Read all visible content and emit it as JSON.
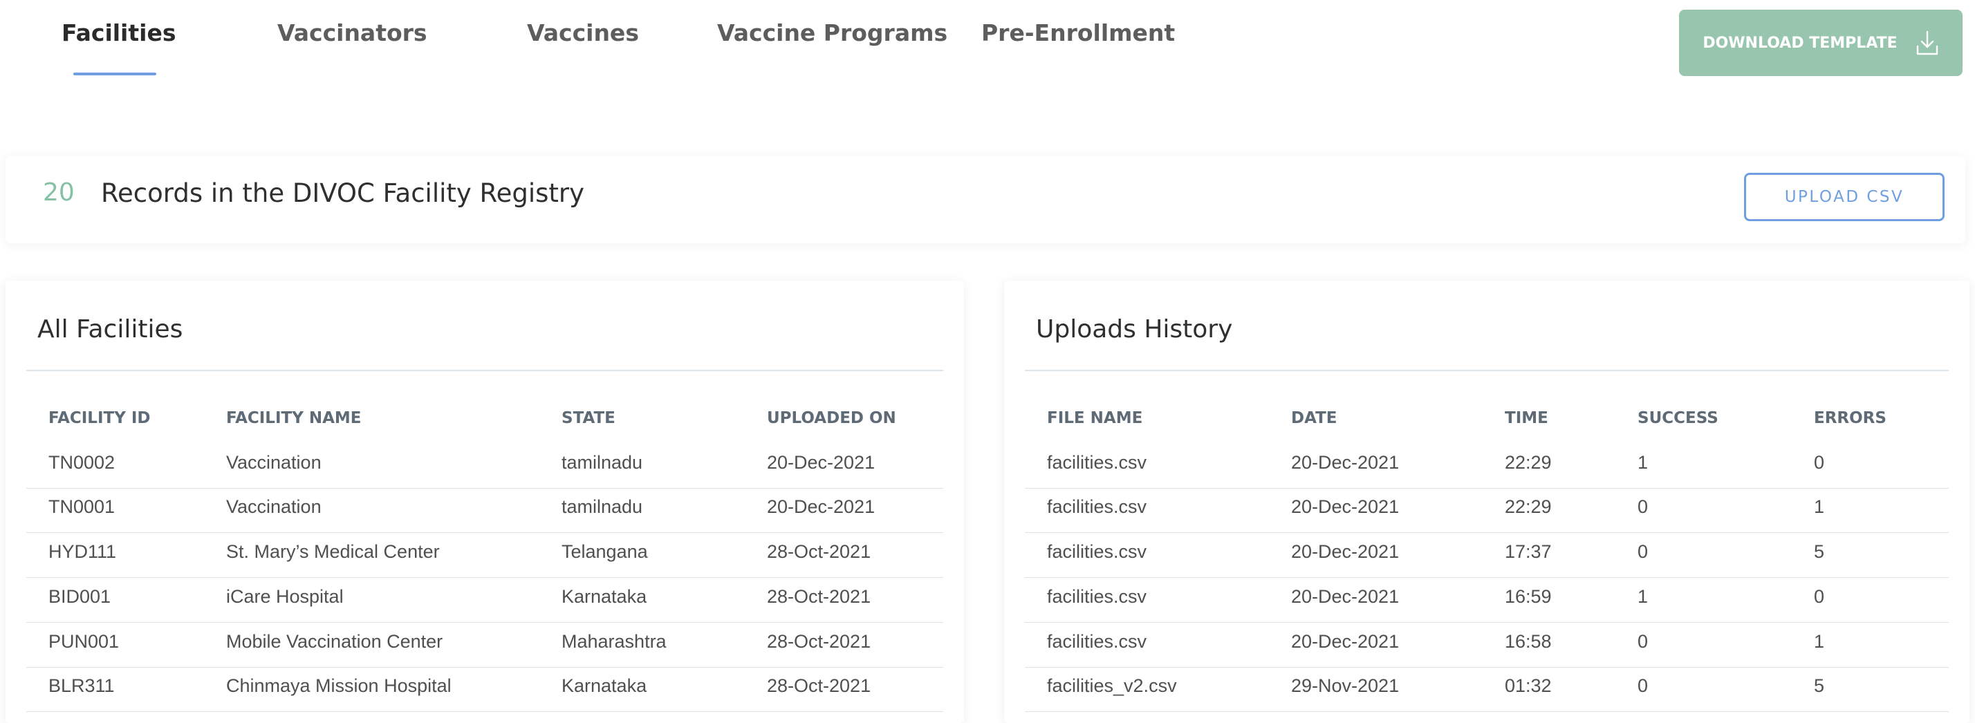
{
  "tabs": [
    {
      "label": "Facilities",
      "active": true
    },
    {
      "label": "Vaccinators",
      "active": false
    },
    {
      "label": "Vaccines",
      "active": false
    },
    {
      "label": "Vaccine Programs",
      "active": false
    },
    {
      "label": "Pre-Enrollment",
      "active": false
    }
  ],
  "download": {
    "label": "DOWNLOAD TEMPLATE",
    "icon": "download-icon"
  },
  "records": {
    "count": "20",
    "title": "Records in the DIVOC Facility Registry",
    "upload_label": "UPLOAD CSV"
  },
  "facilities": {
    "title": "All Facilities",
    "columns": [
      "FACILITY ID",
      "FACILITY NAME",
      "STATE",
      "UPLOADED ON"
    ],
    "rows": [
      [
        "TN0002",
        "Vaccination",
        "tamilnadu",
        "20-Dec-2021"
      ],
      [
        "TN0001",
        "Vaccination",
        "tamilnadu",
        "20-Dec-2021"
      ],
      [
        "HYD111",
        "St. Mary’s Medical Center",
        "Telangana",
        "28-Oct-2021"
      ],
      [
        "BID001",
        "iCare Hospital",
        "Karnataka",
        "28-Oct-2021"
      ],
      [
        "PUN001",
        "Mobile Vaccination Center",
        "Maharashtra",
        "28-Oct-2021"
      ],
      [
        "BLR311",
        "Chinmaya Mission Hospital",
        "Karnataka",
        "28-Oct-2021"
      ]
    ]
  },
  "uploads": {
    "title": "Uploads History",
    "columns": [
      "FILE NAME",
      "DATE",
      "TIME",
      "SUCCESS",
      "ERRORS"
    ],
    "rows": [
      [
        "facilities.csv",
        "20-Dec-2021",
        "22:29",
        "1",
        "0"
      ],
      [
        "facilities.csv",
        "20-Dec-2021",
        "22:29",
        "0",
        "1"
      ],
      [
        "facilities.csv",
        "20-Dec-2021",
        "17:37",
        "0",
        "5"
      ],
      [
        "facilities.csv",
        "20-Dec-2021",
        "16:59",
        "1",
        "0"
      ],
      [
        "facilities.csv",
        "20-Dec-2021",
        "16:58",
        "0",
        "1"
      ],
      [
        "facilities_v2.csv",
        "29-Nov-2021",
        "01:32",
        "0",
        "5"
      ]
    ]
  },
  "colors": {
    "accent_blue": "#6f9fe0",
    "accent_green": "#98c5ad",
    "count_green": "#85c2a4"
  }
}
